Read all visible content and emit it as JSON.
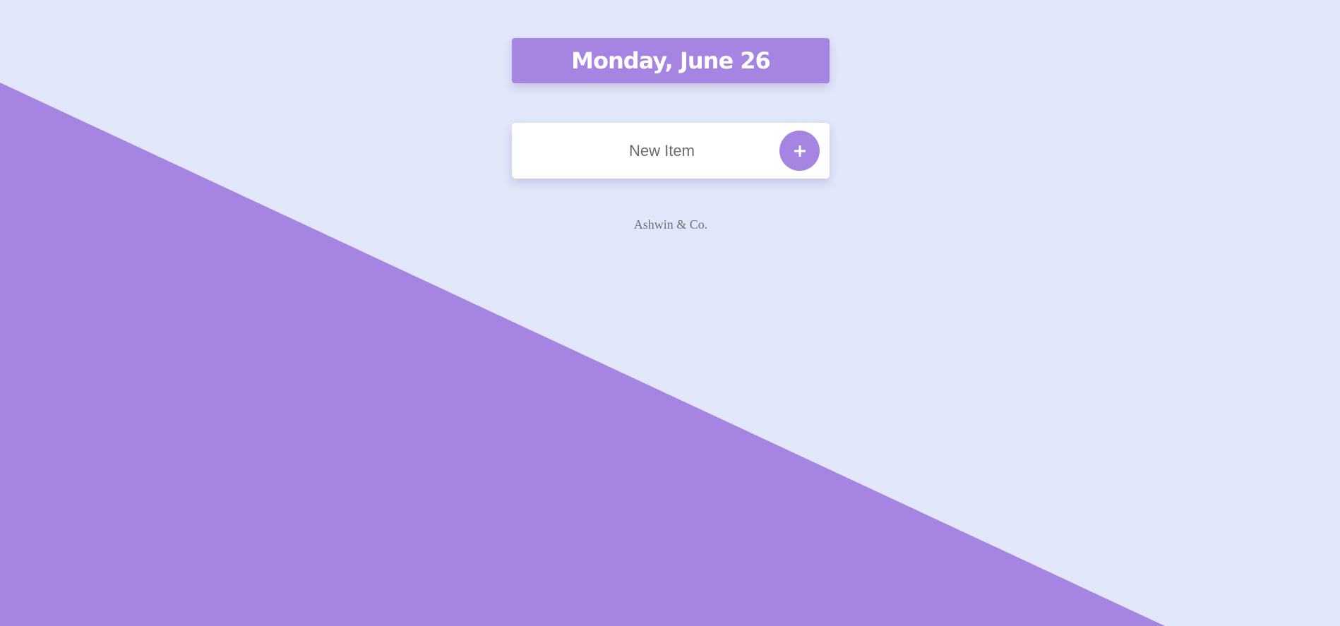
{
  "header": {
    "date_label": "Monday, June 26"
  },
  "new_item_form": {
    "input_placeholder": "New Item",
    "input_value": "",
    "add_button_icon": "plus-icon"
  },
  "footer": {
    "credit": "Ashwin & Co."
  },
  "theme": {
    "accent": "#A684E2",
    "background": "#E2E8FA",
    "card": "#FFFFFF"
  }
}
